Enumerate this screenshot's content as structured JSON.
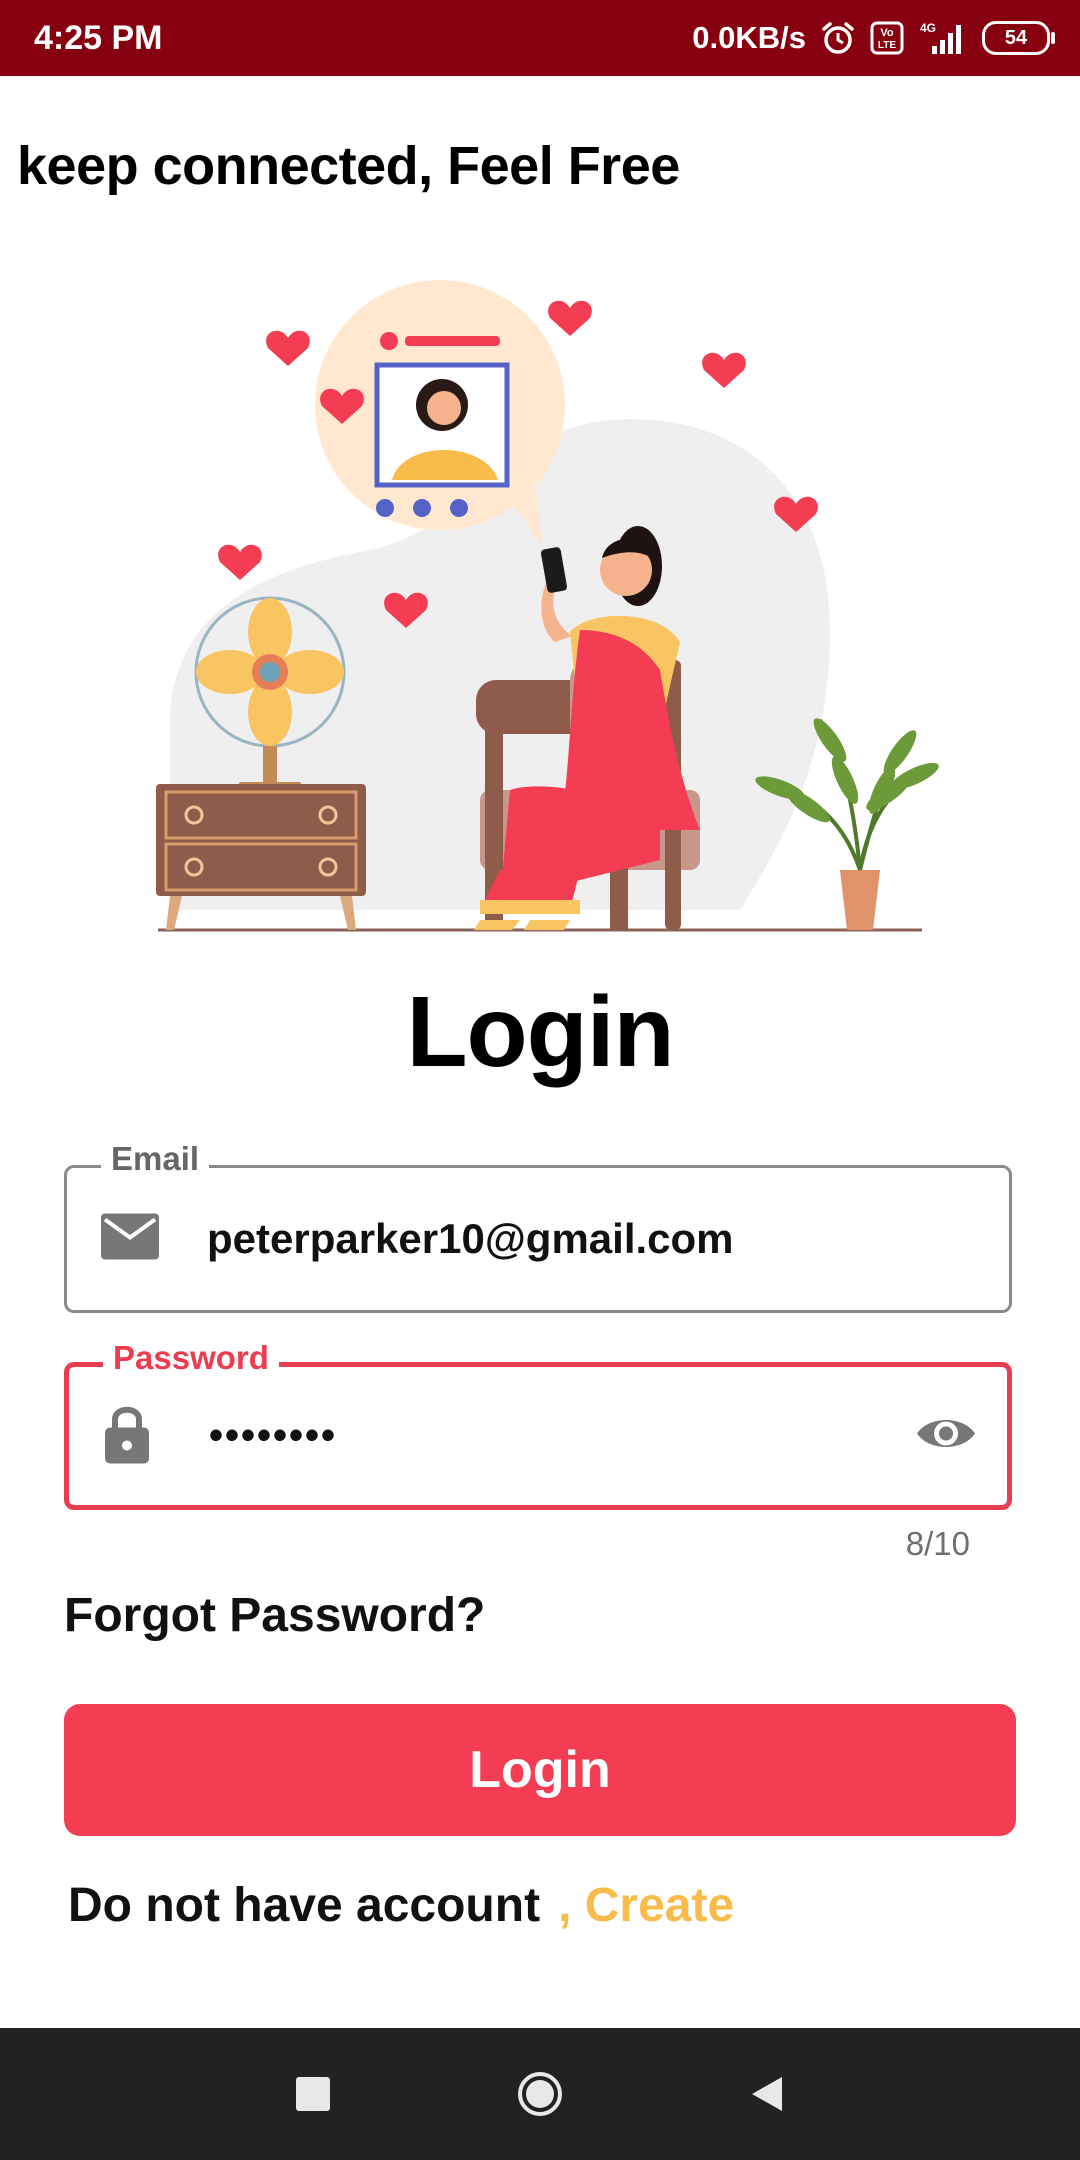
{
  "status_bar": {
    "time": "4:25 PM",
    "net_speed": "0.0KB/s",
    "volte": "Vo\nLTE",
    "network": "4G",
    "battery": "54",
    "icons": [
      "alarm-icon",
      "volte-icon",
      "signal-icon",
      "battery-icon"
    ]
  },
  "header": {
    "tagline": "keep connected, Feel Free"
  },
  "illustration": {
    "subject": "woman-on-chair-with-phone-illustration"
  },
  "form": {
    "title": "Login",
    "email": {
      "label": "Email",
      "value": "peterparker10@gmail.com",
      "icon": "mail-icon"
    },
    "password": {
      "label": "Password",
      "value": "••••••••",
      "icon": "lock-icon",
      "toggle_icon": "eye-icon",
      "counter": "8/10"
    },
    "forgot_label": "Forgot Password?",
    "submit_label": "Login",
    "signup_text": "Do not have account",
    "create_link": ", Create"
  },
  "nav_bar": {
    "buttons": [
      "recents-button",
      "home-button",
      "back-button"
    ]
  },
  "colors": {
    "status_bar": "#870010",
    "accent": "#f43c52",
    "link": "#f9bb4a",
    "nav_bar": "#222222"
  }
}
